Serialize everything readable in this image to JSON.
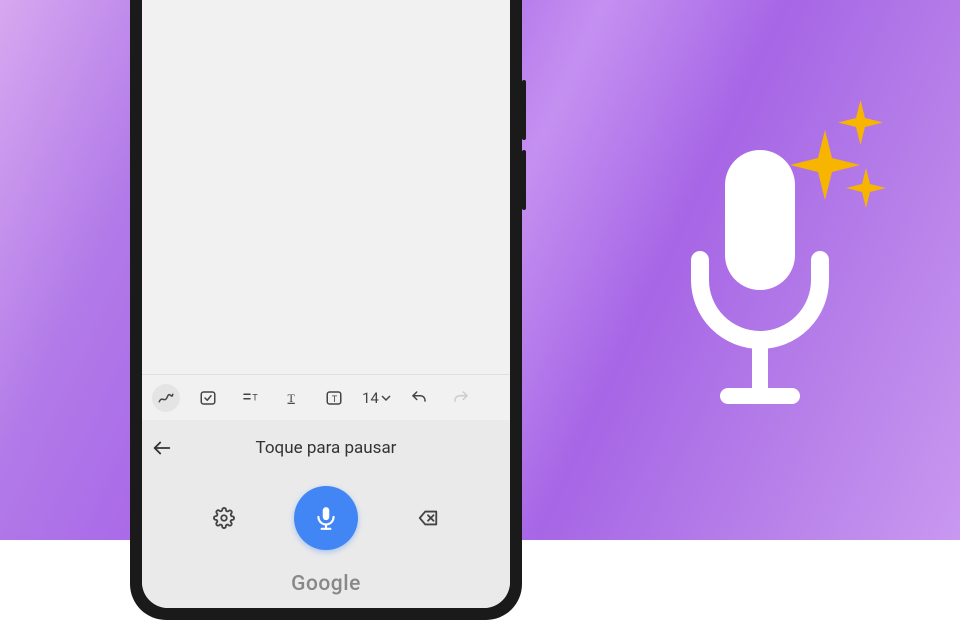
{
  "format_bar": {
    "font_size": "14"
  },
  "voice_panel": {
    "title": "Toque para pausar"
  },
  "brand": "Google",
  "icons": {
    "scribble": "scribble-icon",
    "checkbox": "checkbox-icon",
    "indent": "indent-icon",
    "text_format": "text-format-icon",
    "text_box": "text-box-icon",
    "undo": "undo-icon",
    "redo": "redo-icon",
    "back": "back-arrow-icon",
    "settings": "gear-icon",
    "microphone": "microphone-icon",
    "backspace": "backspace-icon",
    "hero_mic": "microphone-icon",
    "sparkle": "sparkle-icon"
  },
  "colors": {
    "accent": "#4285f4",
    "sparkle": "#f7b500"
  }
}
